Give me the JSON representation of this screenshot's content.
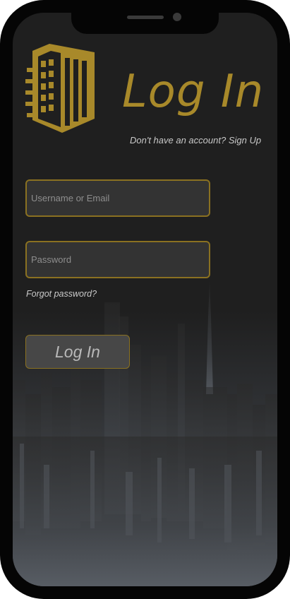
{
  "header": {
    "title": "Log In",
    "signup_prompt": "Don't have an account?",
    "signup_link": "Sign Up"
  },
  "form": {
    "username": {
      "placeholder": "Username or Email",
      "value": ""
    },
    "password": {
      "placeholder": "Password",
      "value": ""
    },
    "forgot_link": "Forgot password?",
    "submit_label": "Log In"
  },
  "colors": {
    "accent": "#a8892a",
    "field_border": "#8a7121",
    "background": "#1f1f1f"
  },
  "icons": {
    "logo": "building-icon"
  }
}
